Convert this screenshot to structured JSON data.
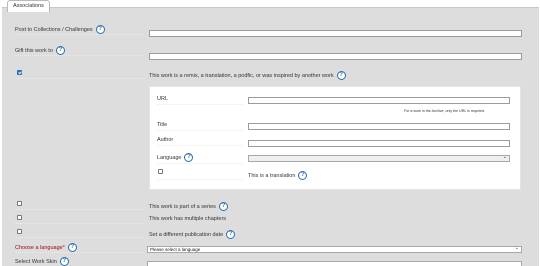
{
  "fieldset": {
    "legend": "Associations"
  },
  "post_to_collections": {
    "label": "Post to Collections / Challenges",
    "value": ""
  },
  "gift_work": {
    "label": "Gift this work to",
    "value": ""
  },
  "remix": {
    "checked": true,
    "text": "This work is a remix, a translation, a podfic, or was inspired by another work",
    "url_label": "URL",
    "url_value": "",
    "url_note": "For a work in the Archive, only the URL is required.",
    "title_label": "Title",
    "title_value": "",
    "author_label": "Author",
    "author_value": "",
    "language_label": "Language",
    "language_value": "",
    "translation_text": "This is a translation"
  },
  "series": {
    "text": "This work is part of a series"
  },
  "chapters": {
    "text": "This work has multiple chapters"
  },
  "pub_date": {
    "text": "Set a different publication date"
  },
  "language": {
    "label": "Choose a language*",
    "value": "Please select a language"
  },
  "work_skin": {
    "label": "Select Work Skin"
  },
  "icons": {
    "help": "help-icon",
    "chevron": "chevron-down-icon",
    "checkbox": "checkbox"
  },
  "colors": {
    "panel": "#dddddd",
    "help_blue": "#2a6fb0",
    "required_red": "#990000"
  }
}
